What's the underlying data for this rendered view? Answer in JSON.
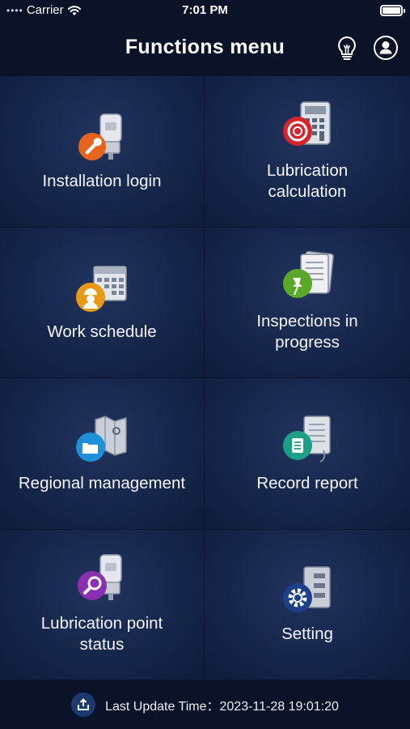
{
  "status_bar": {
    "carrier": "Carrier",
    "time": "7:01 PM"
  },
  "header": {
    "title": "Functions menu",
    "left_icon": "lightbulb-icon",
    "right_icon": "user-icon"
  },
  "menu": [
    {
      "label": "Installation login",
      "icon": "wrench-tank-icon"
    },
    {
      "label": "Lubrication\ncalculation",
      "icon": "calculator-icon"
    },
    {
      "label": "Work schedule",
      "icon": "calendar-worker-icon"
    },
    {
      "label": "Inspections in\nprogress",
      "icon": "clipboard-pin-icon"
    },
    {
      "label": "Regional management",
      "icon": "map-folder-icon"
    },
    {
      "label": "Record report",
      "icon": "report-icon"
    },
    {
      "label": "Lubrication point\nstatus",
      "icon": "tank-search-icon"
    },
    {
      "label": "Setting",
      "icon": "gear-panel-icon"
    }
  ],
  "footer": {
    "label": "Last Update Time：",
    "value": "2023-11-28 19:01:20",
    "icon": "upload-icon"
  },
  "colors": {
    "background": "#0b1530",
    "tile": "#16264a",
    "bar": "#0a1328"
  }
}
